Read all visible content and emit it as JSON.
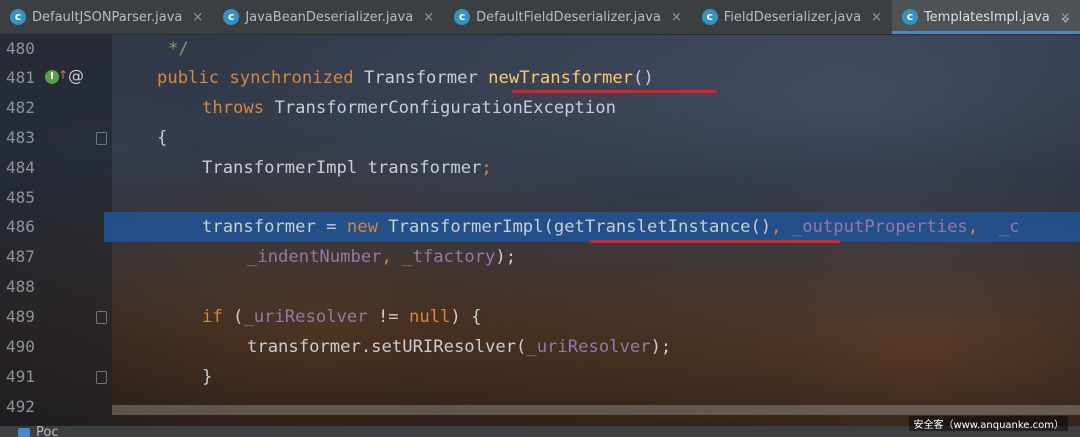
{
  "tabs": [
    {
      "label": "DefaultJSONParser.java",
      "icon": "class-icon",
      "active": false
    },
    {
      "label": "JavaBeanDeserializer.java",
      "icon": "class-icon",
      "active": false
    },
    {
      "label": "DefaultFieldDeserializer.java",
      "icon": "class-icon",
      "active": false
    },
    {
      "label": "FieldDeserializer.java",
      "icon": "class-icon",
      "active": false
    },
    {
      "label": "TemplatesImpl.java",
      "icon": "class-icon",
      "active": true
    }
  ],
  "tab_close_glyph": "×",
  "tab_overflow_glyph": "⌄",
  "class_icon_letter": "c",
  "line_numbers": [
    "480",
    "481",
    "482",
    "483",
    "484",
    "485",
    "486",
    "487",
    "488",
    "489",
    "490",
    "491",
    "492"
  ],
  "code": {
    "l480": "*/",
    "l481_kw": "public synchronized",
    "l481_type": "Transformer",
    "l481_fn": "newTransformer",
    "l481_paren": "()",
    "l482_kw": "throws",
    "l482_type": "TransformerConfigurationException",
    "l483": "{",
    "l484_type": "TransformerImpl transformer",
    "l484_semi": ";",
    "l486_a": "transformer = ",
    "l486_new": "new",
    "l486_b": " TransformerImpl(",
    "l486_call": "getTransletInstance()",
    "l486_comma": ", ",
    "l486_fld": "_outputProperties",
    "l486_comma2": ",  ",
    "l486_trail": "_c",
    "l487_fld1": "_indentNumber",
    "l487_comma": ", ",
    "l487_fld2": "_tfactory",
    "l487_end": ");",
    "l489_kw": "if",
    "l489_a": " (",
    "l489_fld": "_uriResolver",
    "l489_b": " != ",
    "l489_null": "null",
    "l489_c": ") {",
    "l490_a": "transformer.setURIResolver(",
    "l490_fld": "_uriResolver",
    "l490_b": ");",
    "l491": "}"
  },
  "gutter_icons": {
    "implements_letter": "I",
    "arrow": "↑",
    "override": "@"
  },
  "bottom_tab": "Poc",
  "watermark": "安全客（www.anquanke.com）",
  "colors": {
    "selection": "#2153a0",
    "keyword": "#d5873f",
    "field": "#9876aa",
    "method": "#ffc66d",
    "underline": "#e0202a"
  }
}
